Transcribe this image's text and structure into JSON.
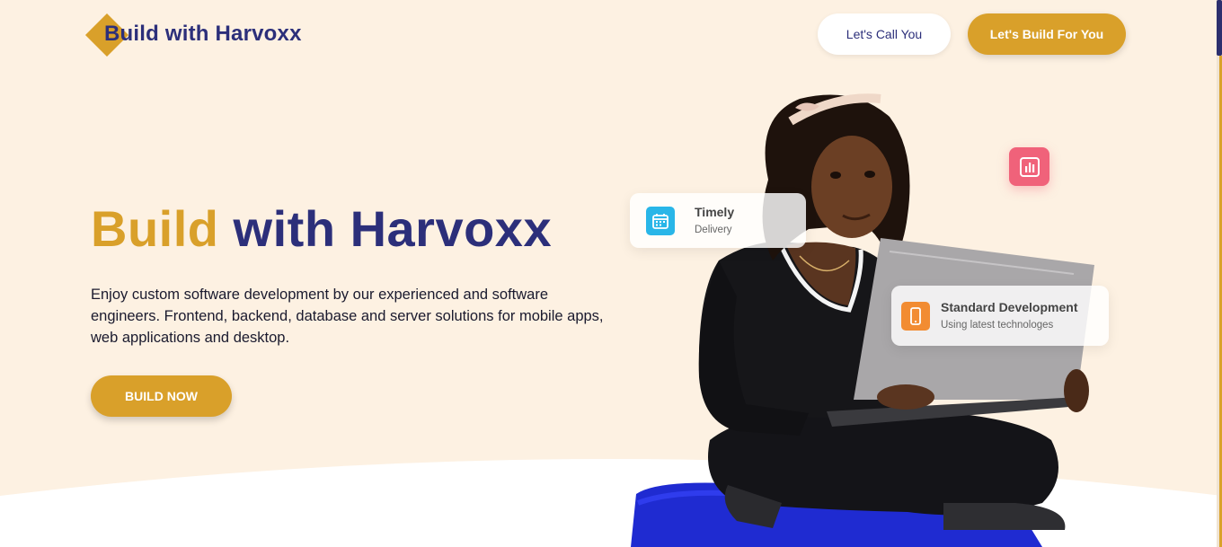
{
  "brand": {
    "name": "Build with Harvoxx"
  },
  "header": {
    "call_label": "Let's Call You",
    "build_label": "Let's Build For You"
  },
  "hero": {
    "title_word1": "Build",
    "title_word2": "with Harvoxx",
    "description": "Enjoy custom software development by our experienced and software engineers. Frontend, backend, database and server solutions for mobile apps, web applications and desktop.",
    "cta_label": "BUILD NOW"
  },
  "cards": {
    "timely": {
      "title": "Timely",
      "subtitle": "Delivery",
      "icon": "calendar-icon"
    },
    "standard": {
      "title": "Standard Development",
      "subtitle": "Using latest technologes",
      "icon": "mobile-phone-icon"
    }
  },
  "badge": {
    "icon": "bar-chart-icon"
  },
  "colors": {
    "background": "#fdf1e2",
    "gold": "#d9a02a",
    "navy": "#2c2f7a",
    "pink": "#f0627a",
    "blue": "#29b6e8",
    "orange": "#f28c32"
  }
}
